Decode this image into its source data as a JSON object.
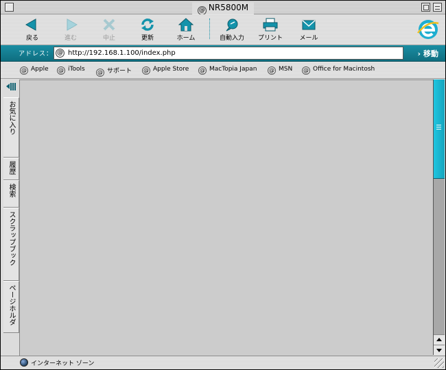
{
  "window": {
    "title": "NR5800M"
  },
  "toolbar": {
    "buttons": [
      {
        "label": "戻る",
        "icon": "back-arrow-icon",
        "enabled": true
      },
      {
        "label": "進む",
        "icon": "forward-arrow-icon",
        "enabled": false
      },
      {
        "label": "中止",
        "icon": "stop-x-icon",
        "enabled": false
      },
      {
        "label": "更新",
        "icon": "refresh-icon",
        "enabled": true
      },
      {
        "label": "ホーム",
        "icon": "home-icon",
        "enabled": true
      },
      {
        "label": "自動入力",
        "icon": "autofill-icon",
        "enabled": true
      },
      {
        "label": "プリント",
        "icon": "printer-icon",
        "enabled": true
      },
      {
        "label": "メール",
        "icon": "mail-icon",
        "enabled": true
      }
    ],
    "logo": "internet-explorer-logo"
  },
  "address_bar": {
    "label": "アドレス：",
    "url": "http://192.168.1.100/index.php",
    "go_label": "移動"
  },
  "favorites": [
    {
      "label": "Apple"
    },
    {
      "label": "iTools"
    },
    {
      "label": "サポート"
    },
    {
      "label": "Apple Store"
    },
    {
      "label": "MacTopia Japan"
    },
    {
      "label": "MSN"
    },
    {
      "label": "Office for Macintosh"
    }
  ],
  "explorer_tabs": [
    {
      "label": "お気に入り"
    },
    {
      "label": "履歴"
    },
    {
      "label": "検索"
    },
    {
      "label": "スクラップブック"
    },
    {
      "label": "ページホルダ"
    }
  ],
  "status_bar": {
    "zone": "インターネット ゾーン"
  },
  "colors": {
    "accent": "#1a8ea3",
    "scroll_thumb": "#1fc5e0",
    "content_bg": "#cccccc"
  }
}
